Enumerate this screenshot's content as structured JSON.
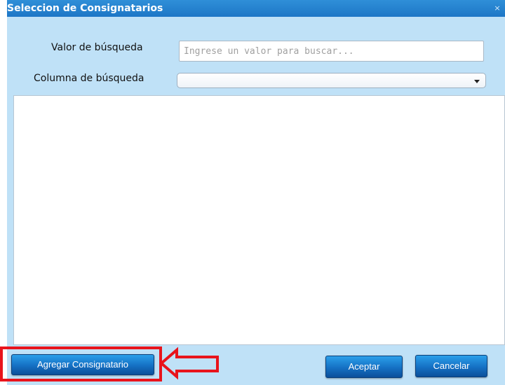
{
  "dialog": {
    "title": "Seleccion de Consignatarios",
    "close_glyph": "×"
  },
  "search": {
    "value_label": "Valor de búsqueda",
    "value": "",
    "placeholder": "Ingrese un valor para buscar...",
    "column_label": "Columna de búsqueda",
    "column_selected": ""
  },
  "results": {
    "items": []
  },
  "buttons": {
    "add_label": "Agregar Consignatario",
    "accept_label": "Aceptar",
    "cancel_label": "Cancelar"
  },
  "annotation": {
    "color": "#e8141c",
    "icon": "left-arrow-outline-icon"
  },
  "colors": {
    "title_bar": "#1d76c6",
    "dialog_bg": "#bfe1f7",
    "button": "#1570c3"
  }
}
